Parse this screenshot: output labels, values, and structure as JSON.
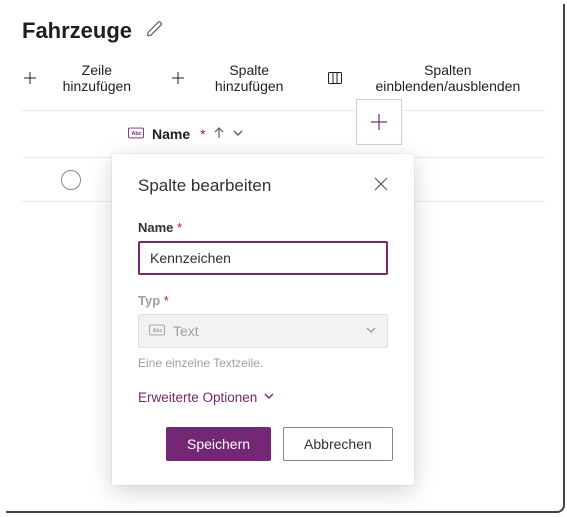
{
  "header": {
    "title": "Fahrzeuge"
  },
  "toolbar": {
    "add_row": "Zeile hinzufügen",
    "add_column": "Spalte hinzufügen",
    "toggle_columns": "Spalten einblenden/ausblenden"
  },
  "columns": {
    "name_label": "Name"
  },
  "panel": {
    "title": "Spalte bearbeiten",
    "name_label": "Name",
    "name_value": "Kennzeichen",
    "type_label": "Typ",
    "type_value": "Text",
    "type_helper": "Eine einzelne Textzeile.",
    "advanced": "Erweiterte Optionen",
    "save": "Speichern",
    "cancel": "Abbrechen"
  }
}
